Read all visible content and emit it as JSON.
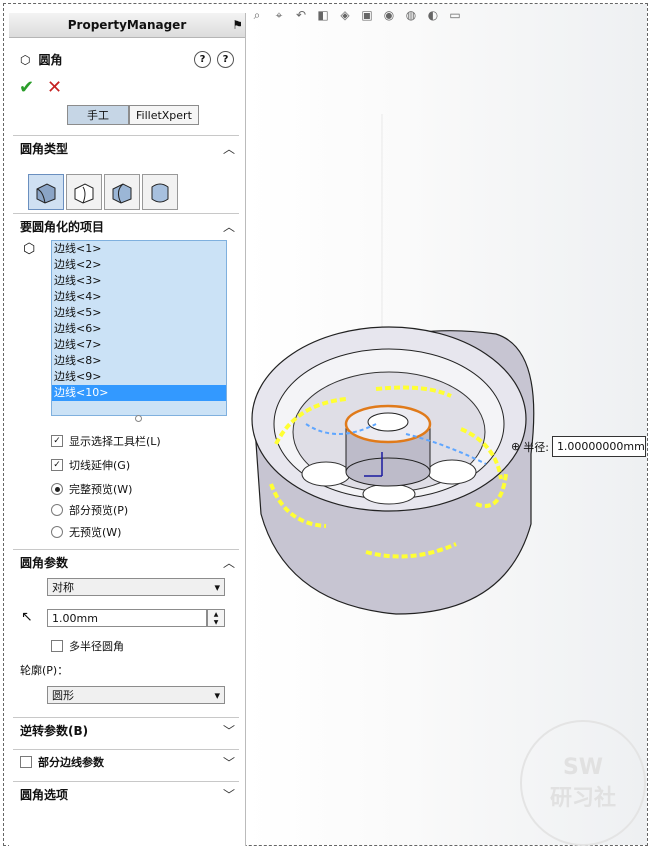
{
  "panel": {
    "title": "PropertyManager",
    "feature_title": "圆角",
    "tabs": [
      "手工",
      "FilletXpert"
    ],
    "sections": {
      "fillet_type": "圆角类型",
      "items_to_fillet": "要圆角化的项目",
      "fillet_params": "圆角参数",
      "setback_params": "逆转参数(B)",
      "partial_edge_params": "部分边线参数",
      "fillet_options": "圆角选项"
    },
    "edges": [
      "边线<1>",
      "边线<2>",
      "边线<3>",
      "边线<4>",
      "边线<5>",
      "边线<6>",
      "边线<7>",
      "边线<8>",
      "边线<9>",
      "边线<10>"
    ],
    "selected_edge_index": 9,
    "options": {
      "show_selection_toolbar": "显示选择工具栏(L)",
      "tangent_propagation": "切线延伸(G)",
      "full_preview": "完整预览(W)",
      "partial_preview": "部分预览(P)",
      "no_preview": "无预览(W)"
    },
    "params": {
      "symmetry": "对称",
      "radius_value": "1.00mm",
      "multi_radius": "多半径圆角",
      "profile_label": "轮廓(P)：",
      "profile_value": "圆形"
    }
  },
  "viewport": {
    "radius_label": "半径:",
    "radius_value": "1.00000000mm",
    "watermark_top": "SW",
    "watermark_bottom": "研习社"
  }
}
